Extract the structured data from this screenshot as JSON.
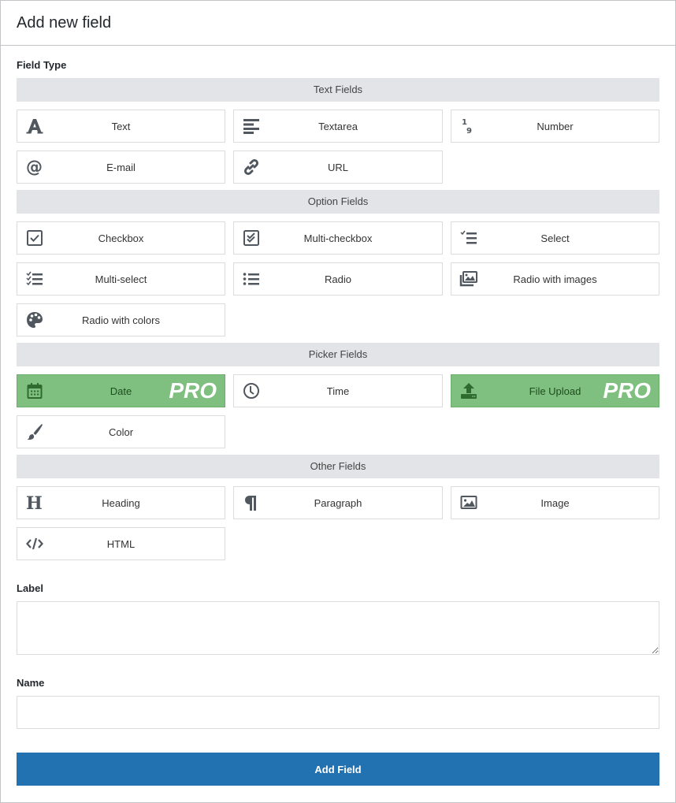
{
  "header": {
    "title": "Add new field"
  },
  "field_type": {
    "label": "Field Type",
    "sections": [
      {
        "heading": "Text Fields",
        "items": [
          {
            "label": "Text",
            "icon": "text-icon",
            "pro": false
          },
          {
            "label": "Textarea",
            "icon": "textarea-icon",
            "pro": false
          },
          {
            "label": "Number",
            "icon": "number-icon",
            "pro": false
          },
          {
            "label": "E-mail",
            "icon": "email-icon",
            "pro": false
          },
          {
            "label": "URL",
            "icon": "link-icon",
            "pro": false
          }
        ]
      },
      {
        "heading": "Option Fields",
        "items": [
          {
            "label": "Checkbox",
            "icon": "checkbox-icon",
            "pro": false
          },
          {
            "label": "Multi-checkbox",
            "icon": "multi-checkbox-icon",
            "pro": false
          },
          {
            "label": "Select",
            "icon": "select-icon",
            "pro": false
          },
          {
            "label": "Multi-select",
            "icon": "multi-select-icon",
            "pro": false
          },
          {
            "label": "Radio",
            "icon": "radio-list-icon",
            "pro": false
          },
          {
            "label": "Radio with images",
            "icon": "images-icon",
            "pro": false
          },
          {
            "label": "Radio with colors",
            "icon": "palette-icon",
            "pro": false
          }
        ]
      },
      {
        "heading": "Picker Fields",
        "items": [
          {
            "label": "Date",
            "icon": "calendar-icon",
            "pro": true,
            "badge": "PRO"
          },
          {
            "label": "Time",
            "icon": "clock-icon",
            "pro": false
          },
          {
            "label": "File Upload",
            "icon": "upload-icon",
            "pro": true,
            "badge": "PRO"
          },
          {
            "label": "Color",
            "icon": "brush-icon",
            "pro": false
          }
        ]
      },
      {
        "heading": "Other Fields",
        "items": [
          {
            "label": "Heading",
            "icon": "heading-icon",
            "pro": false
          },
          {
            "label": "Paragraph",
            "icon": "paragraph-icon",
            "pro": false
          },
          {
            "label": "Image",
            "icon": "image-icon",
            "pro": false
          },
          {
            "label": "HTML",
            "icon": "code-icon",
            "pro": false
          }
        ]
      }
    ]
  },
  "label_field": {
    "label": "Label",
    "value": ""
  },
  "name_field": {
    "label": "Name",
    "value": ""
  },
  "submit": {
    "label": "Add Field"
  },
  "colors": {
    "pro_bg": "#7fbf7f",
    "primary": "#2271b1",
    "section_bg": "#e2e4e7"
  }
}
